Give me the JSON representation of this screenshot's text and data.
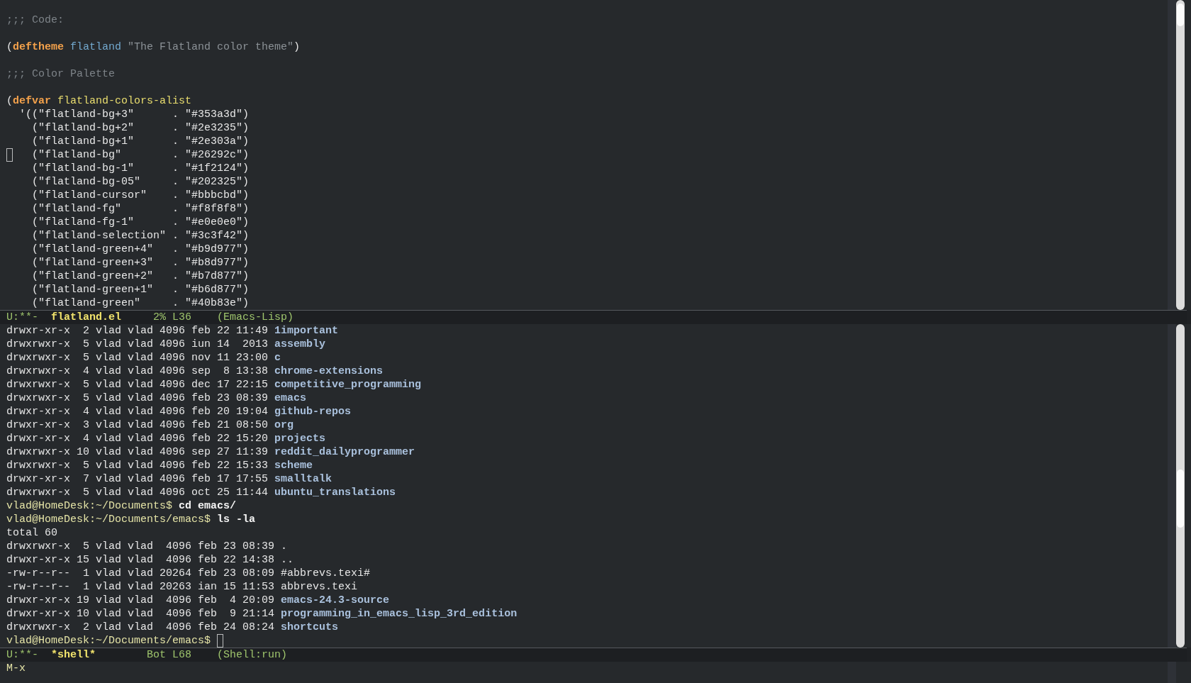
{
  "code_buffer": {
    "blocks": [
      [
        {
          "tokens": [
            {
              "text": ";;; Code:",
              "kind": "comment"
            }
          ],
          "cursor": false
        }
      ],
      [
        {
          "tokens": [
            {
              "text": "(",
              "kind": "plain"
            },
            {
              "text": "deftheme",
              "kind": "keyword"
            },
            {
              "text": " flatland",
              "kind": "name"
            },
            {
              "text": " \"The Flatland color theme\"",
              "kind": "docstring"
            },
            {
              "text": ")",
              "kind": "plain"
            }
          ],
          "cursor": false
        }
      ],
      [
        {
          "tokens": [
            {
              "text": ";;; Color Palette",
              "kind": "comment"
            }
          ],
          "cursor": false
        }
      ],
      [
        {
          "tokens": [
            {
              "text": "(",
              "kind": "plain"
            },
            {
              "text": "defvar",
              "kind": "keyword"
            },
            {
              "text": " flatland-colors-alist",
              "kind": "variable"
            }
          ],
          "cursor": false
        },
        {
          "tokens": [
            {
              "text": "  '((\"flatland-bg+3\"      . \"#353a3d\")",
              "kind": "plain"
            }
          ],
          "cursor": false
        },
        {
          "tokens": [
            {
              "text": "    (\"flatland-bg+2\"      . \"#2e3235\")",
              "kind": "plain"
            }
          ],
          "cursor": false
        },
        {
          "tokens": [
            {
              "text": "    (\"flatland-bg+1\"      . \"#2e303a\")",
              "kind": "plain"
            }
          ],
          "cursor": false
        },
        {
          "tokens": [
            {
              "text": "    (\"flatland-bg\"        . \"#26292c\")",
              "kind": "plain"
            }
          ],
          "cursor": true
        },
        {
          "tokens": [
            {
              "text": "    (\"flatland-bg-1\"      . \"#1f2124\")",
              "kind": "plain"
            }
          ],
          "cursor": false
        },
        {
          "tokens": [
            {
              "text": "    (\"flatland-bg-05\"     . \"#202325\")",
              "kind": "plain"
            }
          ],
          "cursor": false
        },
        {
          "tokens": [
            {
              "text": "    (\"flatland-cursor\"    . \"#bbbcbd\")",
              "kind": "plain"
            }
          ],
          "cursor": false
        },
        {
          "tokens": [
            {
              "text": "    (\"flatland-fg\"        . \"#f8f8f8\")",
              "kind": "plain"
            }
          ],
          "cursor": false
        },
        {
          "tokens": [
            {
              "text": "    (\"flatland-fg-1\"      . \"#e0e0e0\")",
              "kind": "plain"
            }
          ],
          "cursor": false
        },
        {
          "tokens": [
            {
              "text": "    (\"flatland-selection\" . \"#3c3f42\")",
              "kind": "plain"
            }
          ],
          "cursor": false
        },
        {
          "tokens": [
            {
              "text": "    (\"flatland-green+4\"   . \"#b9d977\")",
              "kind": "plain"
            }
          ],
          "cursor": false
        },
        {
          "tokens": [
            {
              "text": "    (\"flatland-green+3\"   . \"#b8d977\")",
              "kind": "plain"
            }
          ],
          "cursor": false
        },
        {
          "tokens": [
            {
              "text": "    (\"flatland-green+2\"   . \"#b7d877\")",
              "kind": "plain"
            }
          ],
          "cursor": false
        },
        {
          "tokens": [
            {
              "text": "    (\"flatland-green+1\"   . \"#b6d877\")",
              "kind": "plain"
            }
          ],
          "cursor": false
        },
        {
          "tokens": [
            {
              "text": "    (\"flatland-green\"     . \"#40b83e\")",
              "kind": "plain"
            }
          ],
          "cursor": false
        }
      ]
    ]
  },
  "code_mode_line": {
    "status": "U:**-",
    "buffer": "flatland.el",
    "position": "2% L36",
    "mode": "(Emacs-Lisp)"
  },
  "shell_buffer": {
    "lines": [
      {
        "tokens": [
          {
            "text": "drwxr-xr-x  2 vlad vlad 4096 feb 22 11:49 ",
            "kind": "plain"
          },
          {
            "text": "1important",
            "kind": "directory"
          }
        ],
        "cursor": false
      },
      {
        "tokens": [
          {
            "text": "drwxrwxr-x  5 vlad vlad 4096 iun 14  2013 ",
            "kind": "plain"
          },
          {
            "text": "assembly",
            "kind": "directory"
          }
        ],
        "cursor": false
      },
      {
        "tokens": [
          {
            "text": "drwxrwxr-x  5 vlad vlad 4096 nov 11 23:00 ",
            "kind": "plain"
          },
          {
            "text": "c",
            "kind": "directory"
          }
        ],
        "cursor": false
      },
      {
        "tokens": [
          {
            "text": "drwxrwxr-x  4 vlad vlad 4096 sep  8 13:38 ",
            "kind": "plain"
          },
          {
            "text": "chrome-extensions",
            "kind": "directory"
          }
        ],
        "cursor": false
      },
      {
        "tokens": [
          {
            "text": "drwxrwxr-x  5 vlad vlad 4096 dec 17 22:15 ",
            "kind": "plain"
          },
          {
            "text": "competitive_programming",
            "kind": "directory"
          }
        ],
        "cursor": false
      },
      {
        "tokens": [
          {
            "text": "drwxrwxr-x  5 vlad vlad 4096 feb 23 08:39 ",
            "kind": "plain"
          },
          {
            "text": "emacs",
            "kind": "directory"
          }
        ],
        "cursor": false
      },
      {
        "tokens": [
          {
            "text": "drwxr-xr-x  4 vlad vlad 4096 feb 20 19:04 ",
            "kind": "plain"
          },
          {
            "text": "github-repos",
            "kind": "directory"
          }
        ],
        "cursor": false
      },
      {
        "tokens": [
          {
            "text": "drwxr-xr-x  3 vlad vlad 4096 feb 21 08:50 ",
            "kind": "plain"
          },
          {
            "text": "org",
            "kind": "directory"
          }
        ],
        "cursor": false
      },
      {
        "tokens": [
          {
            "text": "drwxr-xr-x  4 vlad vlad 4096 feb 22 15:20 ",
            "kind": "plain"
          },
          {
            "text": "projects",
            "kind": "directory"
          }
        ],
        "cursor": false
      },
      {
        "tokens": [
          {
            "text": "drwxrwxr-x 10 vlad vlad 4096 sep 27 11:39 ",
            "kind": "plain"
          },
          {
            "text": "reddit_dailyprogrammer",
            "kind": "directory"
          }
        ],
        "cursor": false
      },
      {
        "tokens": [
          {
            "text": "drwxrwxr-x  5 vlad vlad 4096 feb 22 15:33 ",
            "kind": "plain"
          },
          {
            "text": "scheme",
            "kind": "directory"
          }
        ],
        "cursor": false
      },
      {
        "tokens": [
          {
            "text": "drwxr-xr-x  7 vlad vlad 4096 feb 17 17:55 ",
            "kind": "plain"
          },
          {
            "text": "smalltalk",
            "kind": "directory"
          }
        ],
        "cursor": false
      },
      {
        "tokens": [
          {
            "text": "drwxrwxr-x  5 vlad vlad 4096 oct 25 11:44 ",
            "kind": "plain"
          },
          {
            "text": "ubuntu_translations",
            "kind": "directory"
          }
        ],
        "cursor": false
      },
      {
        "tokens": [
          {
            "text": "vlad@HomeDesk:~/Documents$ ",
            "kind": "prompt"
          },
          {
            "text": "cd emacs/",
            "kind": "command"
          }
        ],
        "cursor": false
      },
      {
        "tokens": [
          {
            "text": "vlad@HomeDesk:~/Documents/emacs$ ",
            "kind": "prompt"
          },
          {
            "text": "ls -la",
            "kind": "command"
          }
        ],
        "cursor": false
      },
      {
        "tokens": [
          {
            "text": "total 60",
            "kind": "plain"
          }
        ],
        "cursor": false
      },
      {
        "tokens": [
          {
            "text": "drwxrwxr-x  5 vlad vlad  4096 feb 23 08:39 .",
            "kind": "plain"
          }
        ],
        "cursor": false
      },
      {
        "tokens": [
          {
            "text": "drwxr-xr-x 15 vlad vlad  4096 feb 22 14:38 ..",
            "kind": "plain"
          }
        ],
        "cursor": false
      },
      {
        "tokens": [
          {
            "text": "-rw-r--r--  1 vlad vlad 20264 feb 23 08:09 #abbrevs.texi#",
            "kind": "plain"
          }
        ],
        "cursor": false
      },
      {
        "tokens": [
          {
            "text": "-rw-r--r--  1 vlad vlad 20263 ian 15 11:53 abbrevs.texi",
            "kind": "plain"
          }
        ],
        "cursor": false
      },
      {
        "tokens": [
          {
            "text": "drwxr-xr-x 19 vlad vlad  4096 feb  4 20:09 ",
            "kind": "plain"
          },
          {
            "text": "emacs-24.3-source",
            "kind": "directory"
          }
        ],
        "cursor": false
      },
      {
        "tokens": [
          {
            "text": "drwxr-xr-x 10 vlad vlad  4096 feb  9 21:14 ",
            "kind": "plain"
          },
          {
            "text": "programming_in_emacs_lisp_3rd_edition",
            "kind": "directory"
          }
        ],
        "cursor": false
      },
      {
        "tokens": [
          {
            "text": "drwxrwxr-x  2 vlad vlad  4096 feb 24 08:24 ",
            "kind": "plain"
          },
          {
            "text": "shortcuts",
            "kind": "directory"
          }
        ],
        "cursor": false
      },
      {
        "tokens": [
          {
            "text": "vlad@HomeDesk:~/Documents/emacs$",
            "kind": "prompt"
          }
        ],
        "cursor": true
      }
    ]
  },
  "shell_mode_line": {
    "status": "U:**-",
    "buffer": "*shell*",
    "position": "Bot L68",
    "mode": "(Shell:run)"
  },
  "minibuffer": {
    "prompt": "M-x"
  }
}
